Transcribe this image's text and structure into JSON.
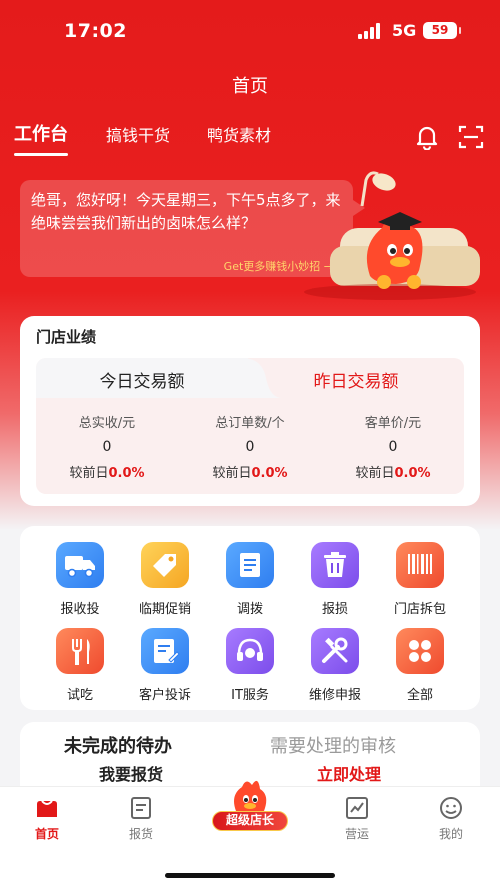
{
  "status_bar": {
    "time": "17:02",
    "network": "5G",
    "battery": "59"
  },
  "header": {
    "title": "首页",
    "tabs": [
      {
        "label": "工作台",
        "active": true
      },
      {
        "label": "搞钱干货",
        "active": false
      },
      {
        "label": "鸭货素材",
        "active": false
      }
    ],
    "icons": [
      "bell-icon",
      "scan-icon"
    ]
  },
  "greeting": {
    "text": "绝哥，您好呀！今天星期三，下午5点多了，来绝味尝尝我们新出的卤味怎么样？",
    "tip": "Get更多赚钱小妙招 →"
  },
  "performance": {
    "title": "门店业绩",
    "tabs": [
      "今日交易额",
      "昨日交易额"
    ],
    "active_tab": "昨日交易额",
    "metrics": [
      {
        "label": "总实收/元",
        "value": "0",
        "compare_prefix": "较前日",
        "compare_value": "0.0%"
      },
      {
        "label": "总订单数/个",
        "value": "0",
        "compare_prefix": "较前日",
        "compare_value": "0.0%"
      },
      {
        "label": "客单价/元",
        "value": "0",
        "compare_prefix": "较前日",
        "compare_value": "0.0%"
      }
    ]
  },
  "quick_actions": [
    {
      "label": "报收投",
      "icon": "truck-icon",
      "color": "#2f8cf0"
    },
    {
      "label": "临期促销",
      "icon": "price-tag-icon",
      "color": "#f5a623"
    },
    {
      "label": "调拨",
      "icon": "transfer-icon",
      "color": "#3b82f6"
    },
    {
      "label": "报损",
      "icon": "trash-icon",
      "color": "#8b5cf6"
    },
    {
      "label": "门店拆包",
      "icon": "barcode-icon",
      "color": "#f25b3a"
    },
    {
      "label": "试吃",
      "icon": "utensils-icon",
      "color": "#f25b3a"
    },
    {
      "label": "客户投诉",
      "icon": "edit-note-icon",
      "color": "#2f8cf0"
    },
    {
      "label": "IT服务",
      "icon": "headset-icon",
      "color": "#8b5cf6"
    },
    {
      "label": "维修申报",
      "icon": "tools-icon",
      "color": "#8b5cf6"
    },
    {
      "label": "全部",
      "icon": "grid-icon",
      "color": "#f25b3a"
    }
  ],
  "todo": {
    "pending_title": "未完成的待办",
    "review_title": "需要处理的审核",
    "pending_action": "我要报货",
    "review_action": "立即处理"
  },
  "bottom_nav": {
    "items": [
      {
        "label": "首页",
        "icon": "home-icon",
        "active": true
      },
      {
        "label": "报货",
        "icon": "order-icon",
        "active": false
      },
      {
        "label": "营运",
        "icon": "chart-icon",
        "active": false
      },
      {
        "label": "我的",
        "icon": "profile-icon",
        "active": false
      }
    ],
    "center_label": "超级店长"
  },
  "colors": {
    "brand_red": "#e41b1b",
    "accent_red": "#e21818",
    "tip_yellow": "#ffd56b"
  }
}
